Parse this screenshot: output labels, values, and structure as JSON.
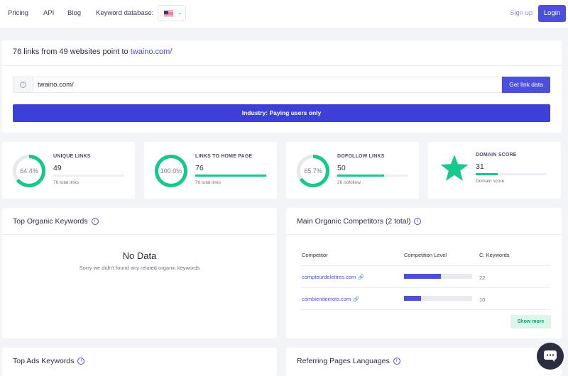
{
  "nav": {
    "pricing": "Pricing",
    "api": "API",
    "blog": "Blog",
    "keyword_database": "Keyword database:",
    "signup": "Sign up",
    "login": "Login"
  },
  "search": {
    "headline_prefix": "76 links from 49 websites point to",
    "headline_domain": "twaino.com/",
    "input_value": "twaino.com/",
    "button": "Get link data",
    "industry": "Industry: Paying users only"
  },
  "stats": [
    {
      "title": "UNIQUE LINKS",
      "value": "49",
      "sub": "76 total links",
      "ring_label": "64.4%",
      "ring_fraction": 0.644,
      "bar_fraction": 0.0
    },
    {
      "title": "LINKS TO HOME PAGE",
      "value": "76",
      "sub": "76 total links",
      "ring_label": "100.0%",
      "ring_fraction": 1.0,
      "bar_fraction": 1.0
    },
    {
      "title": "DOFOLLOW LINKS",
      "value": "50",
      "sub": "26 nofollow",
      "ring_label": "65.7%",
      "ring_fraction": 0.657,
      "bar_fraction": 0.657
    },
    {
      "title": "DOMAIN SCORE",
      "value": "31",
      "sub": "Domain score",
      "bar_fraction": 0.31
    }
  ],
  "organic_keywords": {
    "title": "Top Organic Keywords",
    "empty_title": "No Data",
    "empty_sub": "Sorry we didn't found any related organic keywords"
  },
  "competitors": {
    "title": "Main Organic Competitors (2 total)",
    "headers": [
      "Competitor",
      "Competition Level",
      "C. Keywords"
    ],
    "rows": [
      {
        "name": "compteurdelettres.com",
        "level": 0.54,
        "keywords": "22"
      },
      {
        "name": "combiendemots.com",
        "level": 0.25,
        "keywords": "10"
      }
    ],
    "show_more": "Show more"
  },
  "ads_keywords": {
    "title": "Top Ads Keywords"
  },
  "languages": {
    "title": "Referring Pages Languages"
  },
  "colors": {
    "accent": "#4b4fdc",
    "success": "#15c98a",
    "industry_bar": "#3c40d6"
  }
}
